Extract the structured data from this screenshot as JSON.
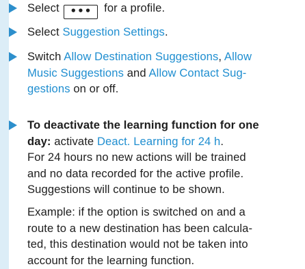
{
  "steps": [
    {
      "before": "Select ",
      "button_glyph": "•••",
      "after": " for a profile."
    },
    {
      "before": "Select ",
      "link": "Suggestion Settings",
      "after": "."
    },
    {
      "before": "Switch ",
      "link1": "Allow Destination Suggestions",
      "sep1": ", ",
      "link2_line1": "Allow",
      "link2_line2": "Music Suggestions",
      "sep2": " and ",
      "link3_line2": "Allow Contact Sug-",
      "link3_line3": "gestions",
      "after": " on or off."
    },
    {
      "bold_line1": "To deactivate the learning function for one",
      "bold_line2": "day:",
      "mid": " activate ",
      "link": "Deact. Learning for 24 h",
      "after": ".",
      "line3": "For 24 hours no new actions will be trained",
      "line4": "and no data recorded for the active profile.",
      "line5": "Suggestions will continue to be shown."
    }
  ],
  "example": {
    "line1": "Example: if the option is switched on and a",
    "line2": "route to a new destination has been calcula-",
    "line3": "ted, this destination would not be taken into",
    "line4": "account for the learning function."
  },
  "colors": {
    "link": "#1f8ed0",
    "marker": "#2d8fcc",
    "gutter": "#dcedf7",
    "text": "#1e1e1e"
  }
}
